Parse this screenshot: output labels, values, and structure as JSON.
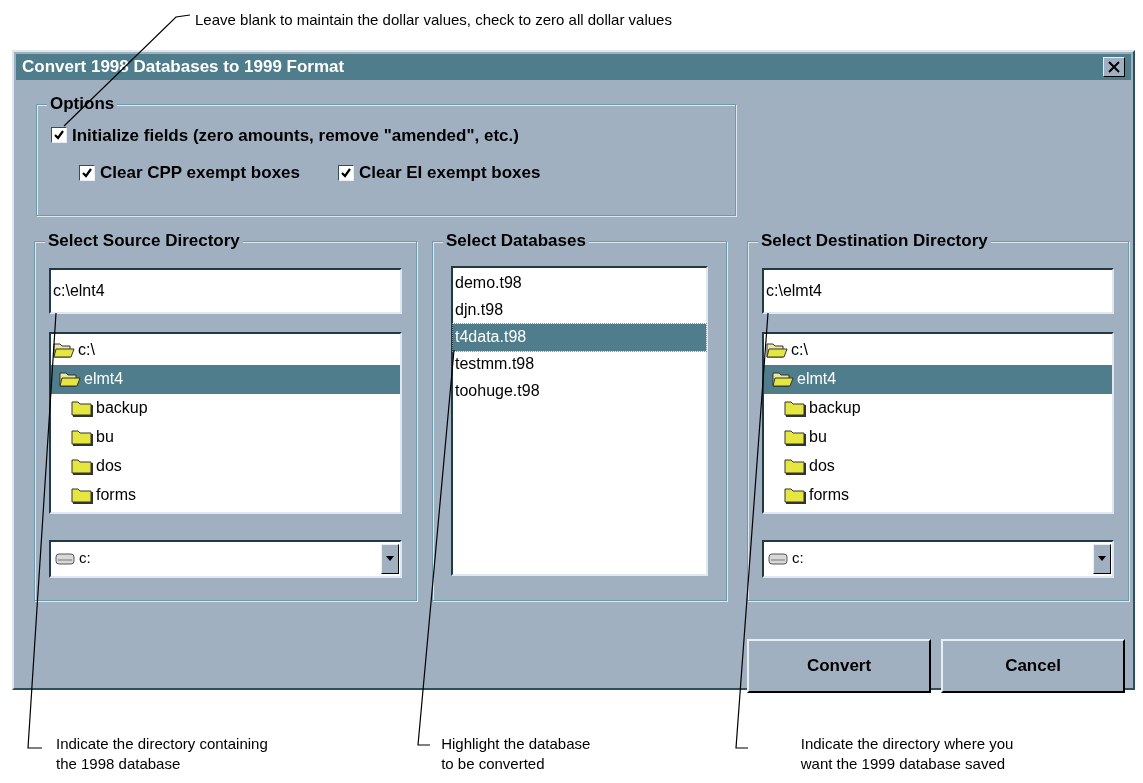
{
  "top_note": "Leave blank to maintain the dollar values, check to zero all dollar values",
  "window": {
    "title": "Convert 1998 Databases to 1999 Format"
  },
  "options": {
    "title": "Options",
    "main_checkbox": {
      "label": "Initialize fields (zero amounts, remove \"amended\", etc.)",
      "checked": true
    },
    "sub_checkboxes": [
      {
        "label": "Clear CPP exempt boxes",
        "checked": true
      },
      {
        "label": "Clear EI exempt boxes",
        "checked": true
      }
    ]
  },
  "source": {
    "title": "Select Source Directory",
    "path": "c:\\elnt4",
    "tree": [
      {
        "label": "c:\\",
        "expanded": true,
        "selected": false,
        "children": [
          {
            "label": "elmt4",
            "expanded": true,
            "selected": true,
            "children": [
              {
                "label": "backup",
                "expanded": false,
                "selected": false
              },
              {
                "label": "bu",
                "expanded": false,
                "selected": false
              },
              {
                "label": "dos",
                "expanded": false,
                "selected": false
              },
              {
                "label": "forms",
                "expanded": false,
                "selected": false
              }
            ]
          }
        ]
      }
    ],
    "drive": "c:"
  },
  "databases": {
    "title": "Select Databases",
    "items": [
      {
        "label": "demo.t98",
        "selected": false
      },
      {
        "label": "djn.t98",
        "selected": false
      },
      {
        "label": "t4data.t98",
        "selected": true
      },
      {
        "label": "testmm.t98",
        "selected": false
      },
      {
        "label": "toohuge.t98",
        "selected": false
      }
    ]
  },
  "destination": {
    "title": "Select Destination Directory",
    "path": "c:\\elmt4",
    "tree": [
      {
        "label": "c:\\",
        "expanded": true,
        "selected": false,
        "children": [
          {
            "label": "elmt4",
            "expanded": true,
            "selected": true,
            "children": [
              {
                "label": "backup",
                "expanded": false,
                "selected": false
              },
              {
                "label": "bu",
                "expanded": false,
                "selected": false
              },
              {
                "label": "dos",
                "expanded": false,
                "selected": false
              },
              {
                "label": "forms",
                "expanded": false,
                "selected": false
              }
            ]
          }
        ]
      }
    ],
    "drive": "c:"
  },
  "buttons": [
    {
      "label": "Convert"
    },
    {
      "label": "Cancel"
    }
  ],
  "bottom_notes": [
    {
      "lines": [
        "Indicate the directory containing",
        "the 1998 database"
      ]
    },
    {
      "lines": [
        "Highlight the database",
        "to be converted"
      ]
    },
    {
      "lines": [
        "Indicate the directory where you",
        "want the 1999 database saved"
      ]
    }
  ]
}
